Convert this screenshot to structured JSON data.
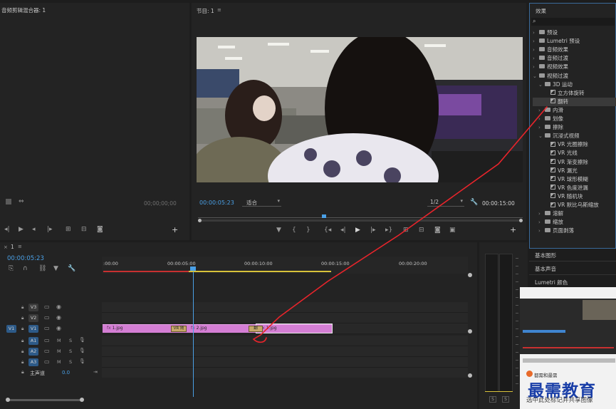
{
  "source_panel": {
    "title": "音频剪辑混合器: 1",
    "timecode": "00;00;00;00"
  },
  "program_panel": {
    "title": "节目: 1",
    "timecode_current": "00:00:05:23",
    "fit_label": "适合",
    "resolution": "1/2",
    "timecode_duration": "00:00:15:00"
  },
  "effects_panel": {
    "title": "效果",
    "search_placeholder": "",
    "items": [
      {
        "label": "预设",
        "kind": "folder",
        "depth": 0,
        "expanded": false
      },
      {
        "label": "Lumetri 预设",
        "kind": "folder",
        "depth": 0,
        "expanded": false
      },
      {
        "label": "音频效果",
        "kind": "folder",
        "depth": 0,
        "expanded": false
      },
      {
        "label": "音频过渡",
        "kind": "folder",
        "depth": 0,
        "expanded": false
      },
      {
        "label": "视频效果",
        "kind": "folder",
        "depth": 0,
        "expanded": false
      },
      {
        "label": "视频过渡",
        "kind": "folder",
        "depth": 0,
        "expanded": true
      },
      {
        "label": "3D 运动",
        "kind": "folder",
        "depth": 1,
        "expanded": true
      },
      {
        "label": "立方体旋转",
        "kind": "effect",
        "depth": 2
      },
      {
        "label": "翻转",
        "kind": "effect",
        "depth": 2,
        "selected": true
      },
      {
        "label": "内滑",
        "kind": "folder",
        "depth": 1,
        "expanded": false
      },
      {
        "label": "划像",
        "kind": "folder",
        "depth": 1,
        "expanded": false
      },
      {
        "label": "擦除",
        "kind": "folder",
        "depth": 1,
        "expanded": false
      },
      {
        "label": "沉浸式视频",
        "kind": "folder",
        "depth": 1,
        "expanded": true
      },
      {
        "label": "VR 光圈擦除",
        "kind": "effect",
        "depth": 2
      },
      {
        "label": "VR 光线",
        "kind": "effect",
        "depth": 2
      },
      {
        "label": "VR 渐变擦除",
        "kind": "effect",
        "depth": 2
      },
      {
        "label": "VR 漏光",
        "kind": "effect",
        "depth": 2
      },
      {
        "label": "VR 球形模糊",
        "kind": "effect",
        "depth": 2
      },
      {
        "label": "VR 色度泄漏",
        "kind": "effect",
        "depth": 2
      },
      {
        "label": "VR 随机块",
        "kind": "effect",
        "depth": 2
      },
      {
        "label": "VR 默比乌斯缩放",
        "kind": "effect",
        "depth": 2
      },
      {
        "label": "溶解",
        "kind": "folder",
        "depth": 1,
        "expanded": false
      },
      {
        "label": "缩放",
        "kind": "folder",
        "depth": 1,
        "expanded": false
      },
      {
        "label": "页面剥落",
        "kind": "folder",
        "depth": 1,
        "expanded": false
      }
    ]
  },
  "side_panels": {
    "basic_graphics": "基本图形",
    "basic_sound": "基本声音",
    "lumetri_color": "Lumetri 颜色"
  },
  "timeline": {
    "tab": "1",
    "timecode": "00:00:05:23",
    "ruler_labels": [
      ":00:00",
      "00:00:05:00",
      "00:00:10:00",
      "00:00:15:00",
      "00:00:20:00"
    ],
    "video_tracks": [
      "V3",
      "V2",
      "V1"
    ],
    "audio_tracks": [
      "A1",
      "A2",
      "A3"
    ],
    "source_v": "V1",
    "master_label": "主声道",
    "master_value": "0.0",
    "mute": "M",
    "solo": "S",
    "clips": [
      {
        "label": "1.jpg"
      },
      {
        "label": "2.jpg"
      },
      {
        "label": "1.jpg"
      }
    ],
    "transition_labels": [
      "VR 随",
      "翻"
    ]
  },
  "meters": {
    "solo_a": "S",
    "solo_b": "S"
  },
  "watermark": {
    "brand": "最需教育",
    "logo_text": "都需和最需",
    "share_text": "选中此处标记并共享图像"
  },
  "colors": {
    "accent_blue": "#4aa0e6",
    "clip_pink": "#d47ed4",
    "annotation_red": "#e8242b",
    "watermark_blue": "#1a3fa8"
  }
}
